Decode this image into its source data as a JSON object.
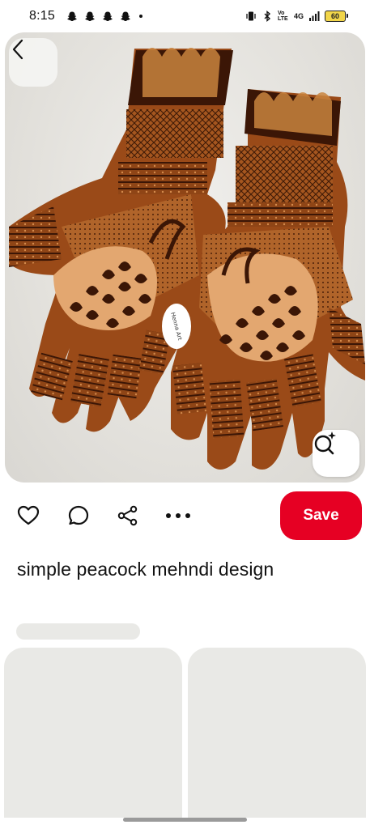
{
  "status_bar": {
    "time": "8:15",
    "notification_icons": [
      "snapchat-icon",
      "snapchat-icon",
      "snapchat-icon",
      "snapchat-icon"
    ],
    "network_label": "4G",
    "volte_label": "Vo LTE",
    "battery_level": "60"
  },
  "pin": {
    "title": "simple peacock mehndi design",
    "watermark": "Henna Art"
  },
  "actions": {
    "save_label": "Save",
    "icons": [
      "heart-icon",
      "comment-icon",
      "share-icon",
      "more-icon"
    ]
  },
  "colors": {
    "save_button": "#e60023",
    "skeleton": "#e9e9e6",
    "henna": "#7a3a14"
  }
}
